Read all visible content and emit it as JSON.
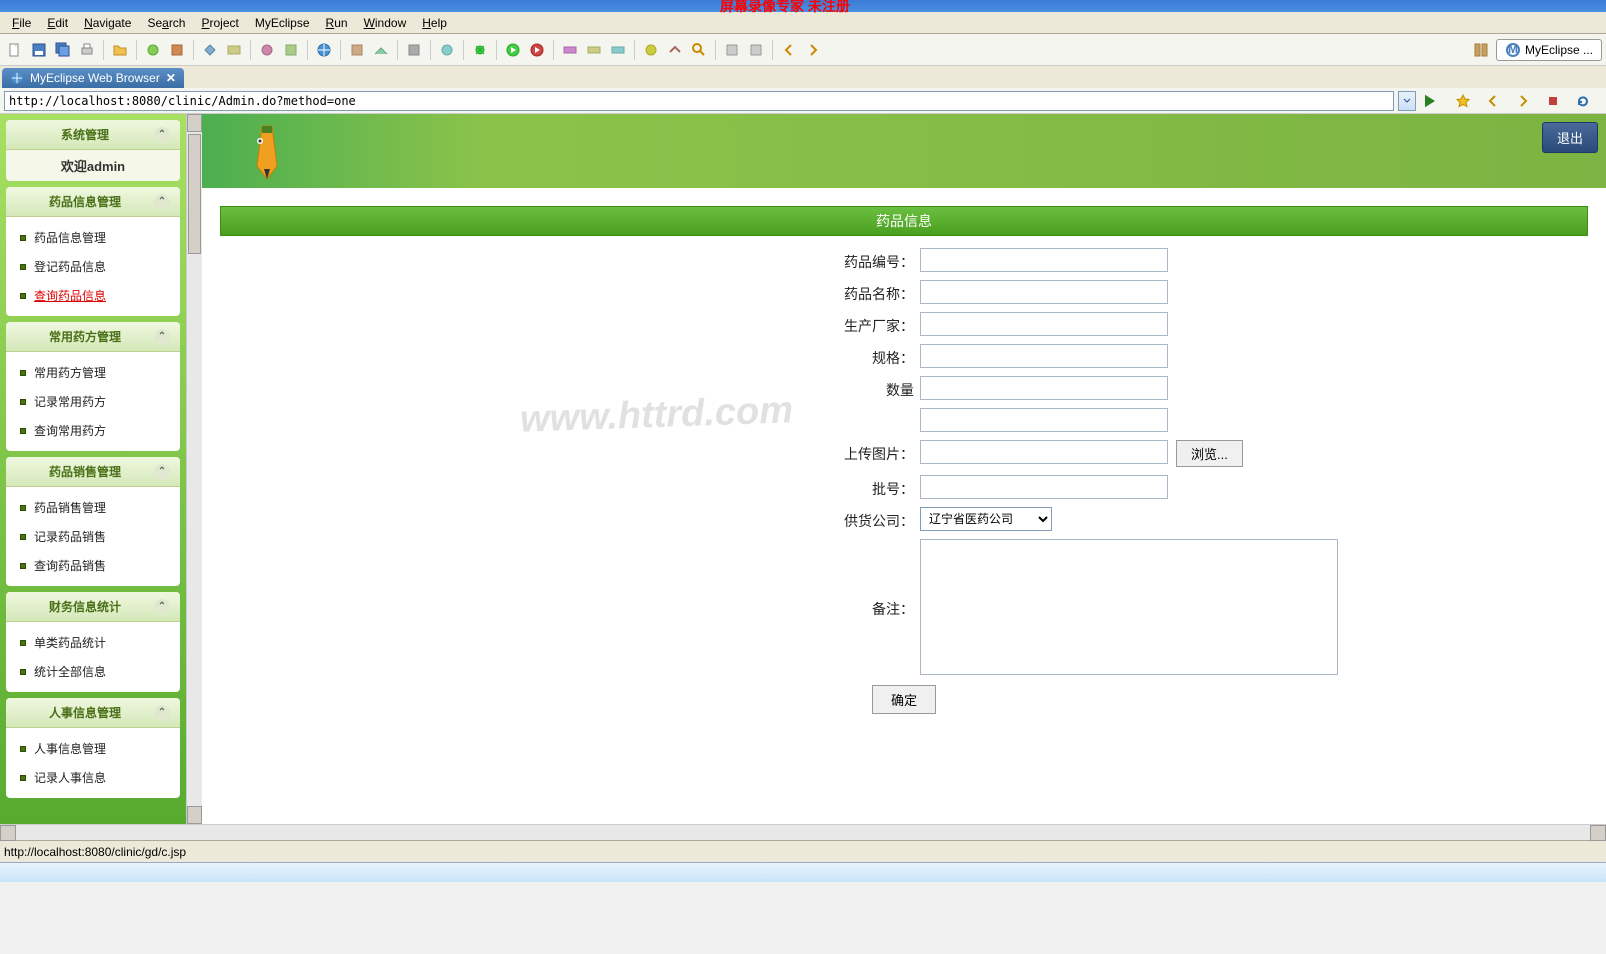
{
  "top_title_red": "屏幕录像专家 未注册",
  "menu": [
    "File",
    "Edit",
    "Navigate",
    "Search",
    "Project",
    "MyEclipse",
    "Run",
    "Window",
    "Help"
  ],
  "perspective_label": "MyEclipse ...",
  "tab_title": "MyEclipse Web Browser",
  "address_url": "http://localhost:8080/clinic/Admin.do?method=one",
  "sidebar": {
    "system_header": "系统管理",
    "welcome": "欢迎admin",
    "groups": [
      {
        "header": "药品信息管理",
        "items": [
          "药品信息管理",
          "登记药品信息",
          "查询药品信息"
        ],
        "active_index": 2
      },
      {
        "header": "常用药方管理",
        "items": [
          "常用药方管理",
          "记录常用药方",
          "查询常用药方"
        ]
      },
      {
        "header": "药品销售管理",
        "items": [
          "药品销售管理",
          "记录药品销售",
          "查询药品销售"
        ]
      },
      {
        "header": "财务信息统计",
        "items": [
          "单类药品统计",
          "统计全部信息"
        ]
      },
      {
        "header": "人事信息管理",
        "items": [
          "人事信息管理",
          "记录人事信息"
        ]
      }
    ]
  },
  "main": {
    "logout": "退出",
    "form_title": "药品信息",
    "fields": {
      "code": "药品编号：",
      "name": "药品名称：",
      "manufacturer": "生产厂家：",
      "spec": "规格：",
      "quantity": "数量",
      "blank": "",
      "upload": "上传图片：",
      "batch": "批号：",
      "supplier": "供货公司：",
      "remark": "备注："
    },
    "supplier_value": "辽宁省医药公司",
    "browse_label": "浏览...",
    "submit_label": "确定"
  },
  "watermark": "www.httrd.com",
  "status_url": "http://localhost:8080/clinic/gd/c.jsp"
}
